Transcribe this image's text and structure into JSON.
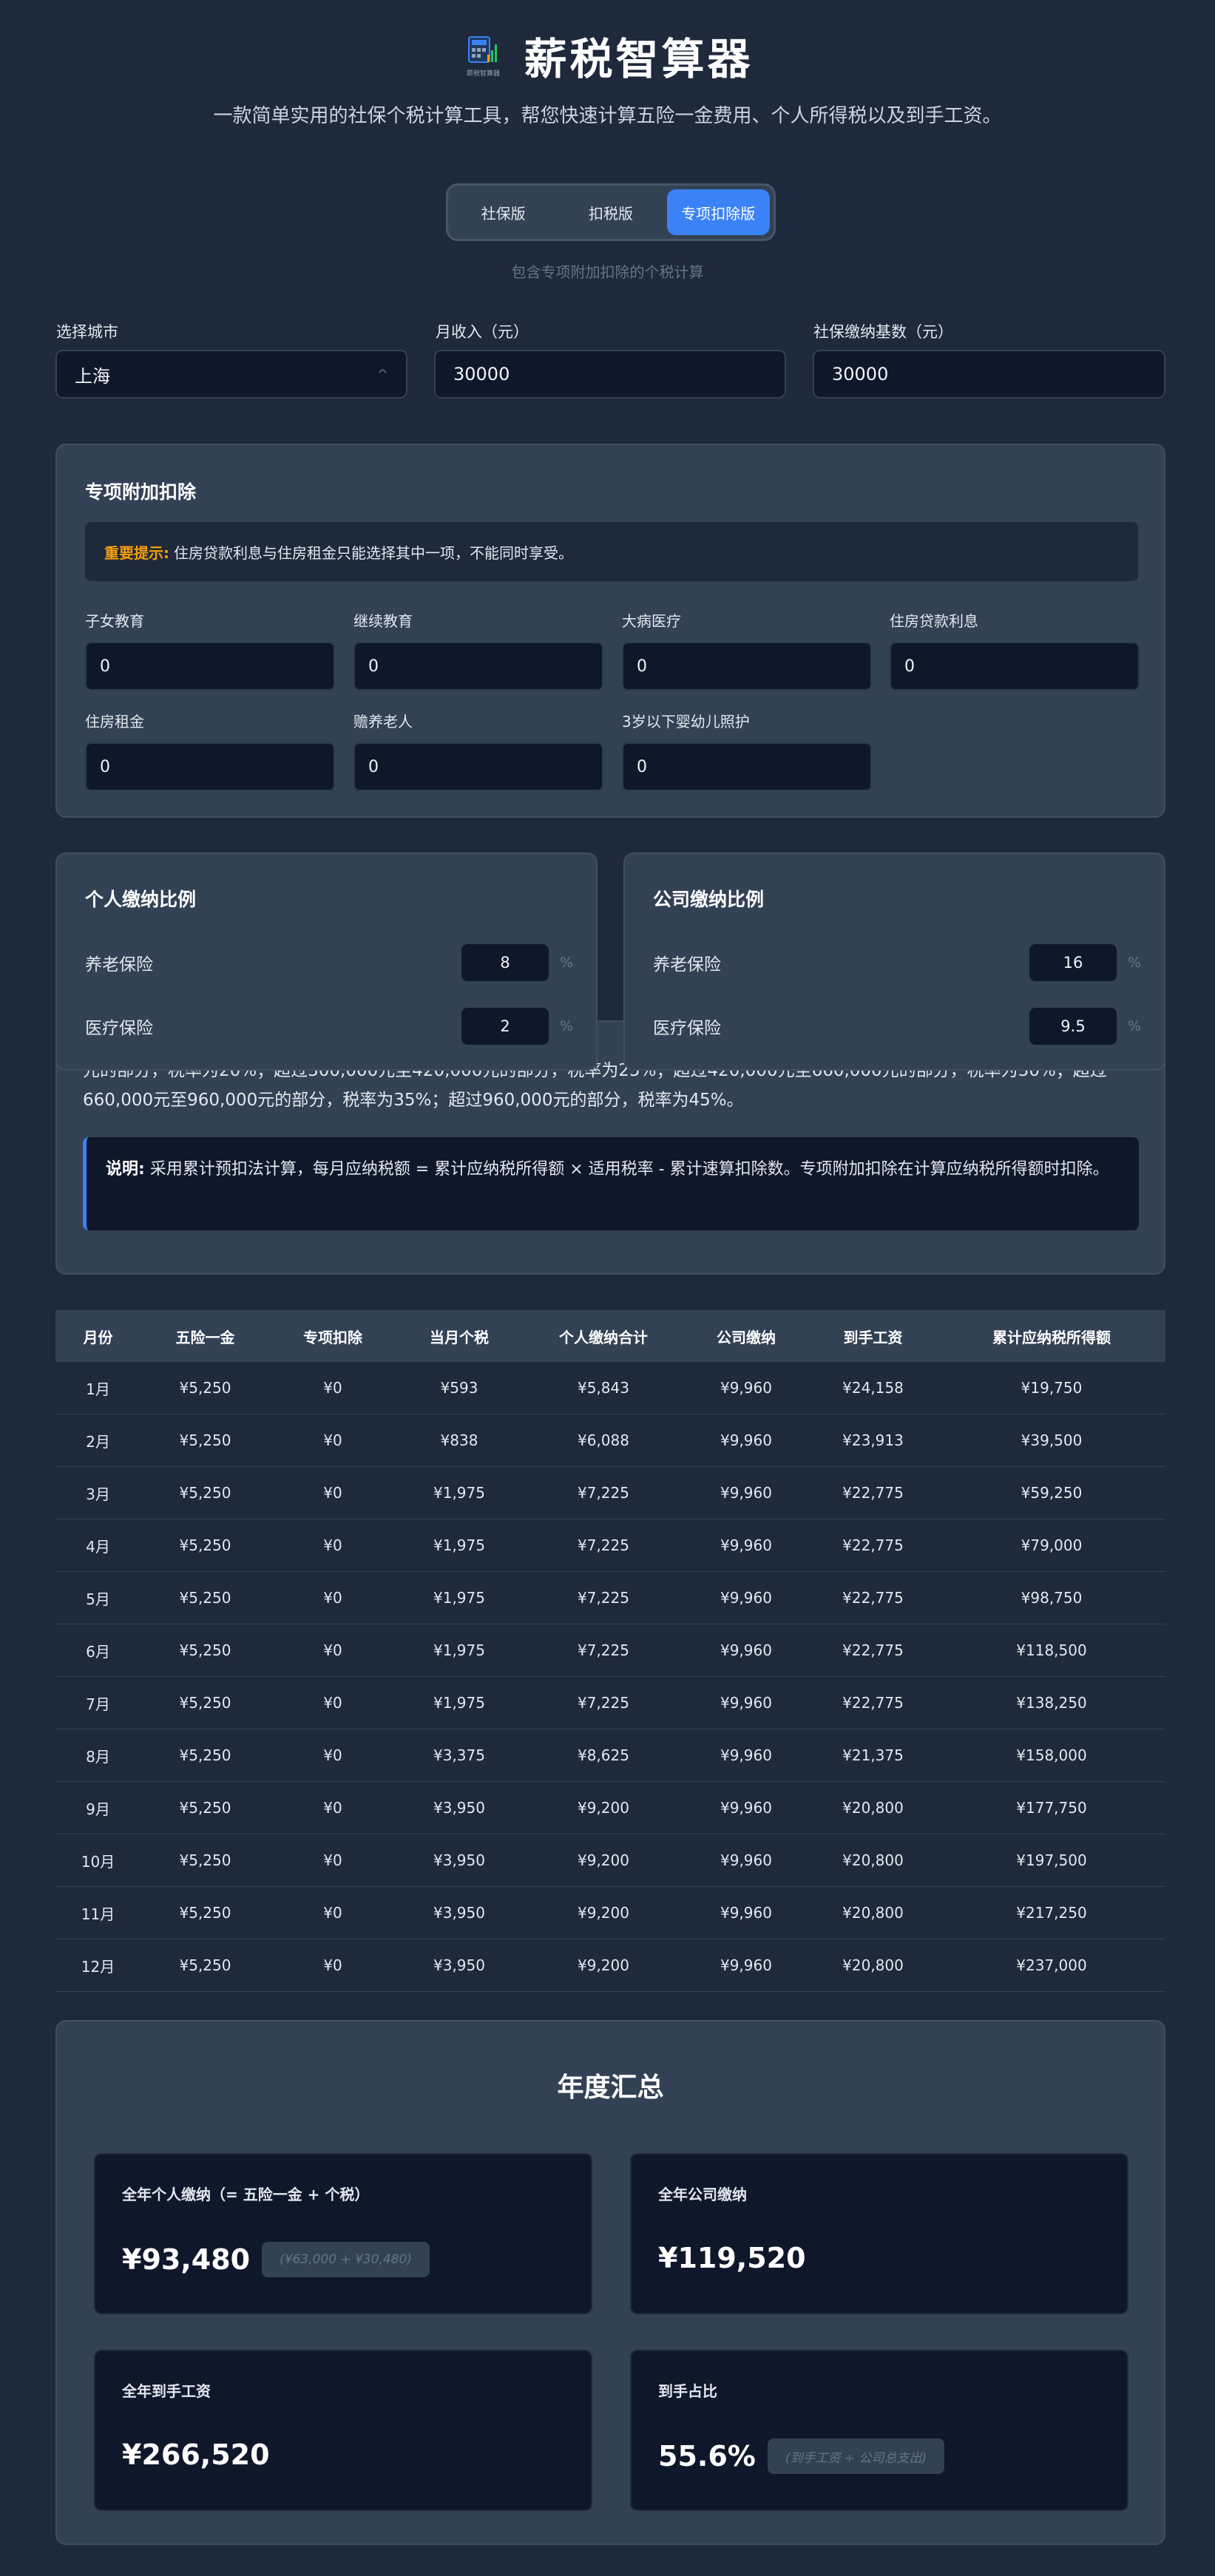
{
  "app": {
    "title": "薪税智算器",
    "logo_caption": "薪税智算器",
    "subtitle": "一款简单实用的社保个税计算工具，帮您快速计算五险一金费用、个人所得税以及到手工资。"
  },
  "tabs": [
    {
      "label": "社保版",
      "active": false
    },
    {
      "label": "扣税版",
      "active": false
    },
    {
      "label": "专项扣除版",
      "active": true
    }
  ],
  "tab_hint": "包含专项附加扣除的个税计算",
  "inputs": {
    "city_label": "选择城市",
    "city_value": "上海",
    "income_label": "月收入（元）",
    "income_value": "30000",
    "base_label": "社保缴纳基数（元）",
    "base_value": "30000"
  },
  "deductions": {
    "title": "专项附加扣除",
    "notice_strong": "重要提示:",
    "notice_text": "住房贷款利息与住房租金只能选择其中一项，不能同时享受。",
    "items": [
      {
        "label": "子女教育",
        "value": "0"
      },
      {
        "label": "继续教育",
        "value": "0"
      },
      {
        "label": "大病医疗",
        "value": "0"
      },
      {
        "label": "住房贷款利息",
        "value": "0"
      },
      {
        "label": "住房租金",
        "value": "0"
      },
      {
        "label": "赡养老人",
        "value": "0"
      },
      {
        "label": "3岁以下婴幼儿照护",
        "value": "0"
      }
    ]
  },
  "personal_ratio": {
    "title": "个人缴纳比例",
    "rows": [
      {
        "name": "养老保险",
        "value": "8",
        "unit": "%"
      },
      {
        "name": "医疗保险",
        "value": "2",
        "unit": "%"
      }
    ]
  },
  "company_ratio": {
    "title": "公司缴纳比例",
    "rows": [
      {
        "name": "养老保险",
        "value": "16",
        "unit": "%"
      },
      {
        "name": "医疗保险",
        "value": "9.5",
        "unit": "%"
      }
    ]
  },
  "tax_rule": {
    "line1": "元的部分，税率为20%；超过300,000元至420,000元的部分，税率为25%；超过420,000元至660,000元的部分，税率为30%；超过",
    "line2": "660,000元至960,000元的部分，税率为35%；超过960,000元的部分，税率为45%。",
    "explain_strong": "说明:",
    "explain_text": "采用累计预扣法计算，每月应纳税额 = 累计应纳税所得额 × 适用税率 - 累计速算扣除数。专项附加扣除在计算应纳税所得额时扣除。"
  },
  "table": {
    "headers": [
      "月份",
      "五险一金",
      "专项扣除",
      "当月个税",
      "个人缴纳合计",
      "公司缴纳",
      "到手工资",
      "累计应纳税所得额"
    ],
    "rows": [
      [
        "1月",
        "¥5,250",
        "¥0",
        "¥593",
        "¥5,843",
        "¥9,960",
        "¥24,158",
        "¥19,750"
      ],
      [
        "2月",
        "¥5,250",
        "¥0",
        "¥838",
        "¥6,088",
        "¥9,960",
        "¥23,913",
        "¥39,500"
      ],
      [
        "3月",
        "¥5,250",
        "¥0",
        "¥1,975",
        "¥7,225",
        "¥9,960",
        "¥22,775",
        "¥59,250"
      ],
      [
        "4月",
        "¥5,250",
        "¥0",
        "¥1,975",
        "¥7,225",
        "¥9,960",
        "¥22,775",
        "¥79,000"
      ],
      [
        "5月",
        "¥5,250",
        "¥0",
        "¥1,975",
        "¥7,225",
        "¥9,960",
        "¥22,775",
        "¥98,750"
      ],
      [
        "6月",
        "¥5,250",
        "¥0",
        "¥1,975",
        "¥7,225",
        "¥9,960",
        "¥22,775",
        "¥118,500"
      ],
      [
        "7月",
        "¥5,250",
        "¥0",
        "¥1,975",
        "¥7,225",
        "¥9,960",
        "¥22,775",
        "¥138,250"
      ],
      [
        "8月",
        "¥5,250",
        "¥0",
        "¥3,375",
        "¥8,625",
        "¥9,960",
        "¥21,375",
        "¥158,000"
      ],
      [
        "9月",
        "¥5,250",
        "¥0",
        "¥3,950",
        "¥9,200",
        "¥9,960",
        "¥20,800",
        "¥177,750"
      ],
      [
        "10月",
        "¥5,250",
        "¥0",
        "¥3,950",
        "¥9,200",
        "¥9,960",
        "¥20,800",
        "¥197,500"
      ],
      [
        "11月",
        "¥5,250",
        "¥0",
        "¥3,950",
        "¥9,200",
        "¥9,960",
        "¥20,800",
        "¥217,250"
      ],
      [
        "12月",
        "¥5,250",
        "¥0",
        "¥3,950",
        "¥9,200",
        "¥9,960",
        "¥20,800",
        "¥237,000"
      ]
    ]
  },
  "summary": {
    "title": "年度汇总",
    "cards": [
      {
        "label": "全年个人缴纳（= 五险一金 + 个税）",
        "value": "¥93,480",
        "note": "(¥63,000 + ¥30,480)"
      },
      {
        "label": "全年公司缴纳",
        "value": "¥119,520",
        "note": ""
      },
      {
        "label": "全年到手工资",
        "value": "¥266,520",
        "note": ""
      },
      {
        "label": "到手占比",
        "value": "55.6%",
        "note": "(到手工资 ÷ 公司总支出)"
      }
    ]
  },
  "colors": {
    "background": "#1e293b",
    "card": "#334155",
    "input": "#0f172a",
    "accent": "#3b82f6",
    "warning": "#f59e0b"
  }
}
